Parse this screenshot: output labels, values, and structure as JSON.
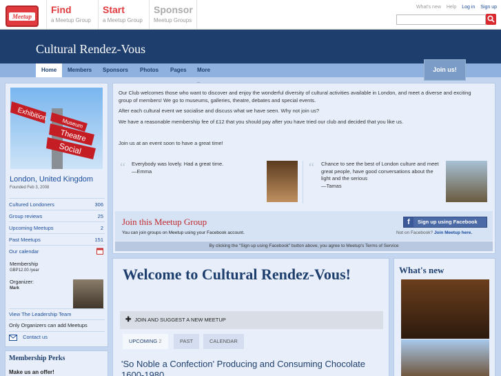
{
  "topbar": {
    "logo_text": "Meetup",
    "nav": [
      {
        "big": "Find",
        "small": "a Meetup Group"
      },
      {
        "big": "Start",
        "small": "a Meetup Group"
      },
      {
        "big": "Sponsor",
        "small": "Meetup Groups"
      }
    ],
    "links": [
      "What's new",
      "Help",
      "Log in",
      "Sign up"
    ],
    "search_placeholder": ""
  },
  "group": {
    "title": "Cultural Rendez-Vous",
    "nav": [
      "Home",
      "Members",
      "Sponsors",
      "Photos",
      "Pages",
      "More ▾"
    ],
    "join_button": "Join us!"
  },
  "sidebar": {
    "image_signs": [
      "Exhibition",
      "Museum",
      "Theatre",
      "Social"
    ],
    "city": "London, United Kingdom",
    "founded": "Founded Feb 3, 2008",
    "stats": [
      {
        "label": "Cultured Londoners",
        "value": "306"
      },
      {
        "label": "Group reviews",
        "value": "25"
      },
      {
        "label": "Upcoming Meetups",
        "value": "2"
      },
      {
        "label": "Past Meetups",
        "value": "151"
      },
      {
        "label": "Our calendar",
        "value": ""
      }
    ],
    "membership_label": "Membership",
    "membership_fee": "GBP12.00 /year",
    "organizer_label": "Organizer:",
    "organizer_name": "Mark",
    "leadership_link": "View The Leadership Team",
    "only_organizers": "Only Organizers can add Meetups",
    "contact": "Contact us",
    "perks_title": "Membership Perks",
    "perks_sub": "Make us an offer!"
  },
  "intro": {
    "p1": "Our Club welcomes those who want to discover and enjoy the wonderful diversity of cultural activities available in London, and meet a diverse and exciting group of members! We go to museums, galleries, theatre, debates and special events.",
    "p2": "After each cultural event we socialise and discuss what we have seen. Why not join us?",
    "p3": "We have a reasonable membership fee of £12 that you should pay after you have tried our club and decided that you like us.",
    "p4": "Join us at an event soon to have a great time!",
    "quote1": "Everybody was lovely. Had a great time.",
    "quote1_author": "—Emma",
    "quote2": "Chance to see the best of London culture and meet great people, have good conversations about the light and the serious",
    "quote2_author": "—Tamas"
  },
  "join": {
    "title": "Join this Meetup Group",
    "sub": "You can join groups on Meetup using your Facebook account.",
    "fb_button": "Sign up using Facebook",
    "not_fb": "Not on Facebook?",
    "join_here": "Join Meetup here.",
    "terms": "By clicking the \"Sign up using Facebook\" button above, you agree to Meetup's Terms of Service"
  },
  "welcome": {
    "title": "Welcome to Cultural Rendez-Vous!",
    "suggest": "JOIN AND SUGGEST A NEW MEETUP",
    "tabs": [
      {
        "label": "UPCOMING",
        "count": "2"
      },
      {
        "label": "PAST",
        "count": ""
      },
      {
        "label": "CALENDAR",
        "count": ""
      }
    ],
    "event_title": "'So Noble a Confection' Producing and Consuming Chocolate 1600-1980"
  },
  "whats_new": {
    "title": "What's new"
  },
  "colors": {
    "meetup_red": "#e0393e",
    "header_navy": "#1e3f6d",
    "link_blue": "#1a4b9b",
    "facebook_blue": "#4b6aa6"
  }
}
